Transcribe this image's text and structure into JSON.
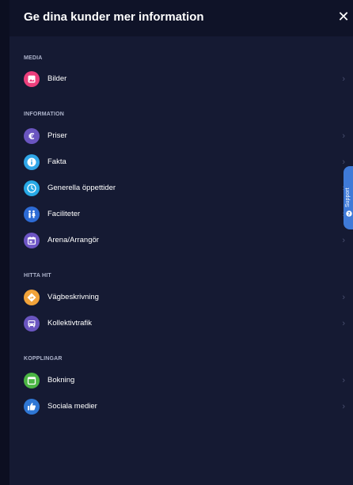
{
  "header": {
    "title": "Ge dina kunder mer information",
    "close_symbol": "✕"
  },
  "sections": {
    "media": {
      "title": "MEDIA",
      "items": [
        {
          "label": "Bilder",
          "icon": "image-icon",
          "color": "#ec3f7c"
        }
      ]
    },
    "information": {
      "title": "INFORMATION",
      "items": [
        {
          "label": "Priser",
          "icon": "euro-icon",
          "color": "#6a55c0"
        },
        {
          "label": "Fakta",
          "icon": "info-icon",
          "color": "#2fa6e8"
        },
        {
          "label": "Generella öppettider",
          "icon": "clock-icon",
          "color": "#27a9e6"
        },
        {
          "label": "Faciliteter",
          "icon": "restroom-icon",
          "color": "#2d6bd5"
        },
        {
          "label": "Arena/Arrangör",
          "icon": "calendar-icon",
          "color": "#6d55c4"
        }
      ]
    },
    "hitta_hit": {
      "title": "HITTA HIT",
      "items": [
        {
          "label": "Vägbeskrivning",
          "icon": "directions-icon",
          "color": "#f2a33a"
        },
        {
          "label": "Kollektivtrafik",
          "icon": "bus-icon",
          "color": "#6a55c0"
        }
      ]
    },
    "kopplingar": {
      "title": "KOPPLINGAR",
      "items": [
        {
          "label": "Bokning",
          "icon": "booking-calendar-icon",
          "color": "#4bb544"
        },
        {
          "label": "Sociala medier",
          "icon": "thumbs-up-icon",
          "color": "#2f77d5"
        }
      ]
    }
  },
  "chevron": "›",
  "support_tab": {
    "label": "Support",
    "icon": "help-icon",
    "color": "#3f7ad8"
  }
}
